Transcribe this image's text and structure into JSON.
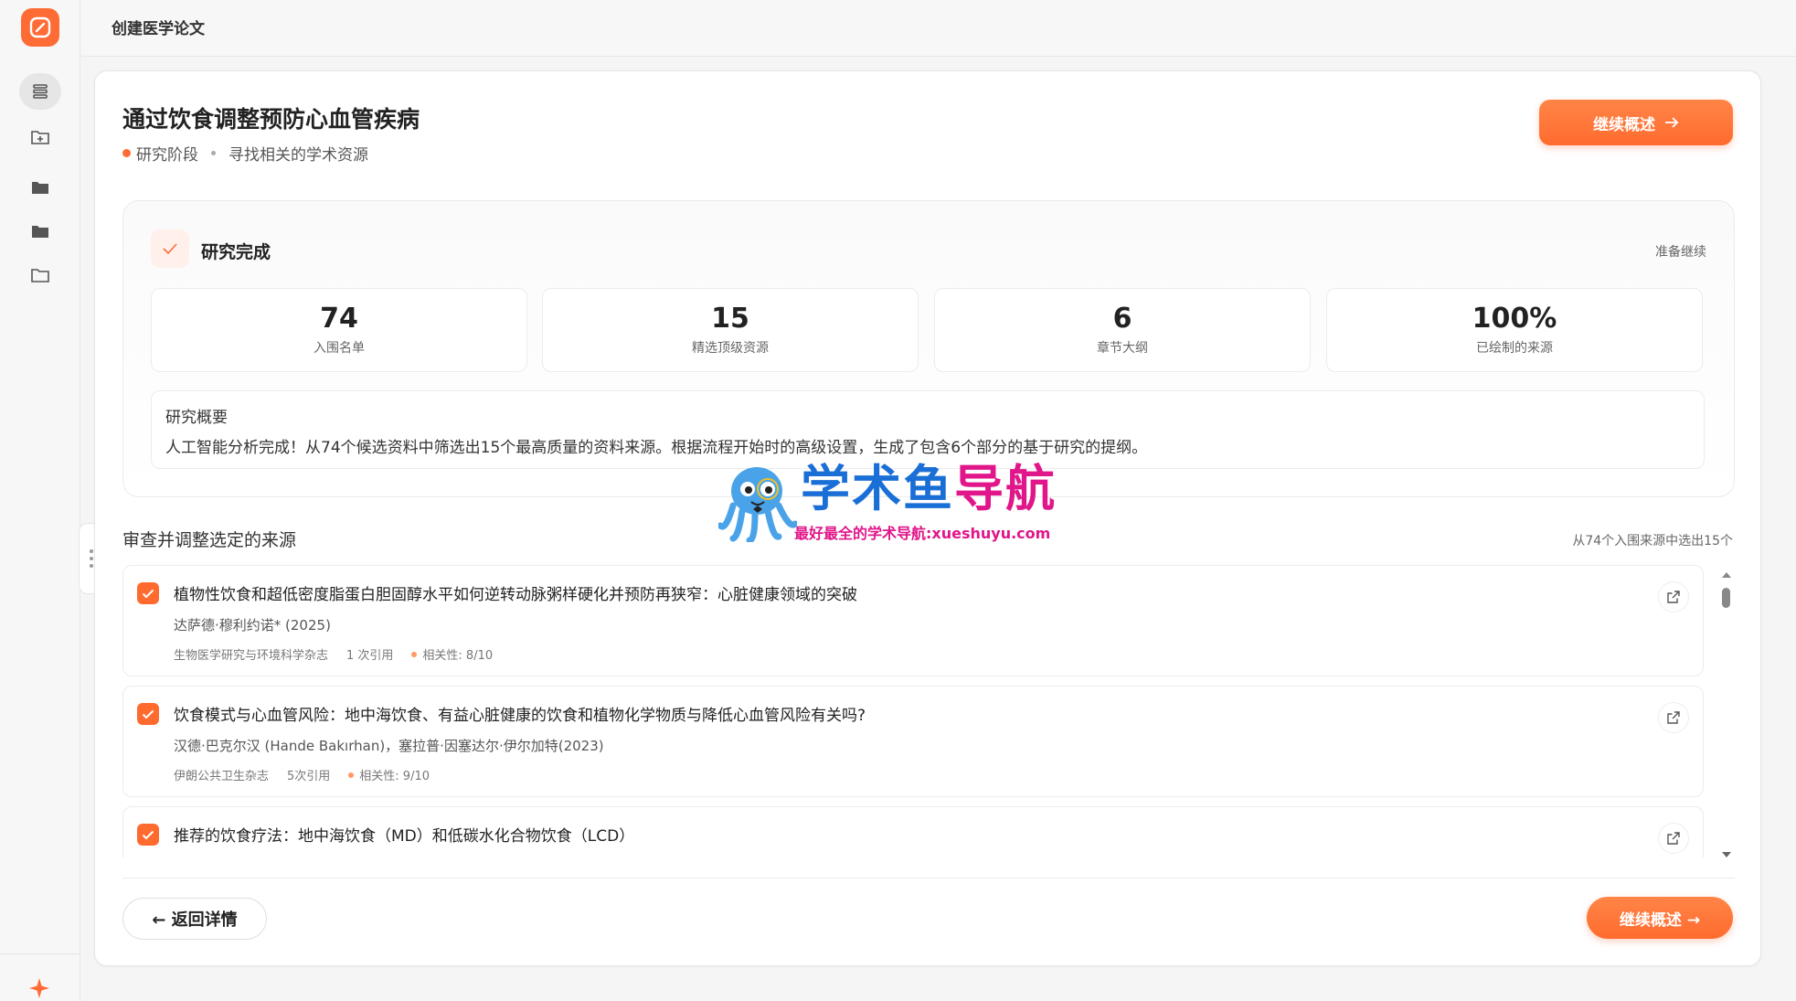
{
  "app": {
    "title": "创建医学论文"
  },
  "page": {
    "title": "通过饮食调整预防心血管疾病",
    "stage": "研究阶段",
    "sub_stage": "寻找相关的学术资源",
    "continue_label": "继续概述"
  },
  "research": {
    "title": "研究完成",
    "status": "准备继续",
    "stats": [
      {
        "value": "74",
        "label": "入围名单"
      },
      {
        "value": "15",
        "label": "精选顶级资源"
      },
      {
        "value": "6",
        "label": "章节大纲"
      },
      {
        "value": "100%",
        "label": "已绘制的来源"
      }
    ],
    "summary_title": "研究概要",
    "summary_text": "人工智能分析完成！从74个候选资料中筛选出15个最高质量的资料来源。根据流程开始时的高级设置，生成了包含6个部分的基于研究的提纲。"
  },
  "sources": {
    "heading": "审查并调整选定的来源",
    "count_label": "从74个入围来源中选出15个",
    "items": [
      {
        "title": "植物性饮食和超低密度脂蛋白胆固醇水平如何逆转动脉粥样硬化并预防再狭窄：心脏健康领域的突破",
        "author": "达萨德·穆利约诺* (2025)",
        "journal": "生物医学研究与环境科学杂志",
        "citations": "1 次引用",
        "relevance": "相关性:  8/10"
      },
      {
        "title": "饮食模式与心血管风险：地中海饮食、有益心脏健康的饮食和植物化学物质与降低心血管风险有关吗?",
        "author": "汉德·巴克尔汉 (Hande Bakırhan)，塞拉普·因塞达尔·伊尔加特(2023)",
        "journal": "伊朗公共卫生杂志",
        "citations": "5次引用",
        "relevance": "相关性:  9/10"
      },
      {
        "title": "推荐的饮食疗法：地中海饮食（MD）和低碳水化合物饮食（LCD）",
        "author": "",
        "journal": "",
        "citations": "",
        "relevance": ""
      }
    ]
  },
  "footer": {
    "back_label": "← 返回详情",
    "continue_label": "继续概述 →"
  },
  "watermark": {
    "part1": "学术鱼",
    "part2": "导航",
    "subtitle": "最好最全的学术导航:xueshuyu.com"
  },
  "colors": {
    "accent": "#ff6b35",
    "watermark_blue": "#1a6fd6",
    "watermark_pink": "#e0168a"
  },
  "icons": [
    "logo-icon",
    "stack-icon",
    "folder-plus-icon",
    "folder-icon",
    "folder-outline-icon",
    "sparkle-icon",
    "check-icon",
    "external-link-icon"
  ]
}
